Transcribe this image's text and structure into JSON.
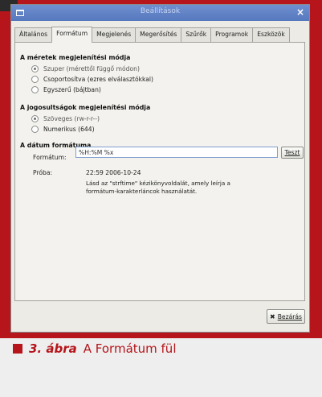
{
  "window": {
    "title": "Beállítások",
    "close_glyph": "×"
  },
  "tabs": [
    {
      "label": "Általános",
      "active": false
    },
    {
      "label": "Formátum",
      "active": true
    },
    {
      "label": "Megjelenés",
      "active": false
    },
    {
      "label": "Megerősítés",
      "active": false
    },
    {
      "label": "Szűrők",
      "active": false
    },
    {
      "label": "Programok",
      "active": false
    },
    {
      "label": "Eszközök",
      "active": false
    }
  ],
  "size_section": {
    "title": "A méretek megjelenítési módja",
    "options": [
      {
        "label": "Szuper (mérettől függő módon)",
        "checked": true
      },
      {
        "label": "Csoportosítva (ezres elválasztókkal)",
        "checked": false
      },
      {
        "label": "Egyszerű (bájtban)",
        "checked": false
      }
    ]
  },
  "perm_section": {
    "title": "A jogosultságok megjelenítési módja",
    "options": [
      {
        "label": "Szöveges (rw-r-r--)",
        "checked": true
      },
      {
        "label": "Numerikus (644)",
        "checked": false
      }
    ]
  },
  "date_section": {
    "title": "A dátum formátuma",
    "format_label": "Formátum:",
    "format_value": "%H:%M %x",
    "test_button": "Teszt",
    "preview_label": "Próba:",
    "preview_value": "22:59 2006-10-24",
    "help_text": "Lásd az \"strftime\" kézikönyvoldalát, amely leírja a formátum-karakterláncok használatát."
  },
  "footer": {
    "close_button": "Bezárás",
    "close_icon": "✖"
  },
  "caption": {
    "number": "3. ábra",
    "text": "A Formátum fül"
  }
}
